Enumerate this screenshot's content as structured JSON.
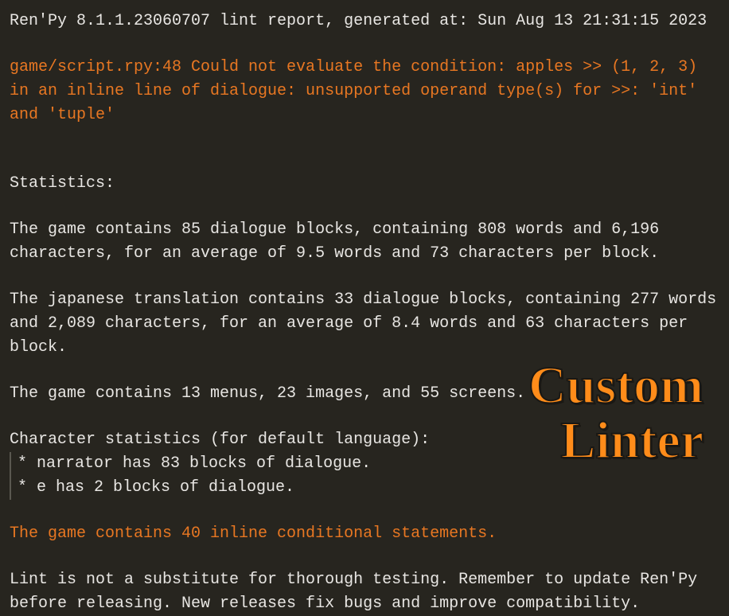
{
  "header": "Ren'Py 8.1.1.23060707 lint report, generated at: Sun Aug 13 21:31:15 2023",
  "error": "game/script.rpy:48 Could not evaluate the condition: apples >> (1, 2, 3) in an inline line of dialogue: unsupported operand type(s) for >>: 'int' and 'tuple'",
  "statisticsHeader": "Statistics:",
  "stats": {
    "dialogueBlocks": "The game contains 85 dialogue blocks, containing 808 words and 6,196 characters, for an average of 9.5 words and 73 characters per block.",
    "japaneseTranslation": "The japanese translation contains 33 dialogue blocks, containing 277 words and 2,089 characters, for an average of 8.4 words and 63 characters per block.",
    "menusImagesScreens": "The game contains 13 menus, 23 images, and 55 screens."
  },
  "characterStats": {
    "header": "Character statistics (for default language):",
    "items": [
      " * narrator has 83 blocks of dialogue.",
      " * e has 2 blocks of dialogue."
    ]
  },
  "inlineConditional": "The game contains 40 inline conditional statements.",
  "footerNote": "Lint is not a substitute for thorough testing. Remember to update Ren'Py before releasing. New releases fix bugs and improve compatibility.",
  "overlay": {
    "line1": "Custom",
    "line2": "Linter"
  }
}
